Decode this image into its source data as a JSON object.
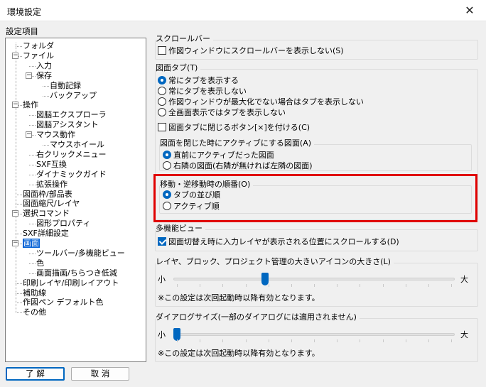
{
  "window": {
    "title": "環境設定",
    "close_glyph": "✕"
  },
  "tree": {
    "label": "設定項目",
    "items": [
      {
        "text": "フォルダ"
      },
      {
        "text": "ファイル",
        "expander": "−"
      },
      {
        "text": "入力"
      },
      {
        "text": "保存",
        "expander": "−"
      },
      {
        "text": "自動記録"
      },
      {
        "text": "バックアップ"
      },
      {
        "text": "操作",
        "expander": "−"
      },
      {
        "text": "図脳エクスプローラ"
      },
      {
        "text": "図脳アシスタント"
      },
      {
        "text": "マウス動作",
        "expander": "−"
      },
      {
        "text": "マウスホイール"
      },
      {
        "text": "右クリックメニュー"
      },
      {
        "text": "SXF互換"
      },
      {
        "text": "ダイナミックガイド"
      },
      {
        "text": "拡張操作"
      },
      {
        "text": "図面枠/部品表"
      },
      {
        "text": "図面縮尺/レイヤ"
      },
      {
        "text": "選択コマンド",
        "expander": "−"
      },
      {
        "text": "図形プロパティ"
      },
      {
        "text": "SXF詳細設定"
      },
      {
        "text": "画面",
        "expander": "−",
        "selected": true
      },
      {
        "text": "ツールバー/多機能ビュー"
      },
      {
        "text": "色"
      },
      {
        "text": "画面描画/ちらつき低減"
      },
      {
        "text": "印刷レイヤ/印刷レイアウト"
      },
      {
        "text": "補助線"
      },
      {
        "text": "作図ペン デフォルト色"
      },
      {
        "text": "その他"
      }
    ]
  },
  "buttons": {
    "ok": "了 解",
    "cancel": "取 消"
  },
  "scroll_group": {
    "title": "スクロールバー",
    "hide_scrollbar": {
      "label": "作図ウィンドウにスクロールバーを表示しない(S)",
      "checked": false
    }
  },
  "tab_group": {
    "title": "図面タブ(T)",
    "options": [
      {
        "label": "常にタブを表示する",
        "checked": true
      },
      {
        "label": "常にタブを表示しない",
        "checked": false
      },
      {
        "label": "作図ウィンドウが最大化でない場合はタブを表示しない",
        "checked": false
      },
      {
        "label": "全画面表示ではタブを表示しない",
        "checked": false
      }
    ],
    "close_button": {
      "label": "図面タブに閉じるボタン[×]を付ける(C)",
      "checked": false
    },
    "active_on_close": {
      "title": "図面を閉じた時にアクティブにする図面(A)",
      "options": [
        {
          "label": "直前にアクティブだった図面",
          "checked": true
        },
        {
          "label": "右隣の図面(右隣が無ければ左隣の図面)",
          "checked": false
        }
      ]
    },
    "move_order": {
      "title": "移動・逆移動時の順番(O)",
      "options": [
        {
          "label": "タブの並び順",
          "checked": true
        },
        {
          "label": "アクティブ順",
          "checked": false
        }
      ]
    }
  },
  "multi_view": {
    "title": "多機能ビュー",
    "scroll_on_switch": {
      "label": "図面切替え時に入力レイヤが表示される位置にスクロールする(D)",
      "checked": true
    }
  },
  "icon_size": {
    "title": "レイヤ、ブロック、プロジェクト管理の大きいアイコンの大きさ(L)",
    "min_label": "小",
    "max_label": "大",
    "value_fraction": 0.32,
    "note": "※この設定は次回起動時以降有効となります。"
  },
  "dialog_size": {
    "title": "ダイアログサイズ(一部のダイアログには適用されません)",
    "min_label": "小",
    "max_label": "大",
    "value_fraction": 0.0,
    "note": "※この設定は次回起動時以降有効となります。"
  },
  "colors": {
    "accent": "#0067c0",
    "selection": "#0a64d6",
    "highlight": "#e00000"
  }
}
